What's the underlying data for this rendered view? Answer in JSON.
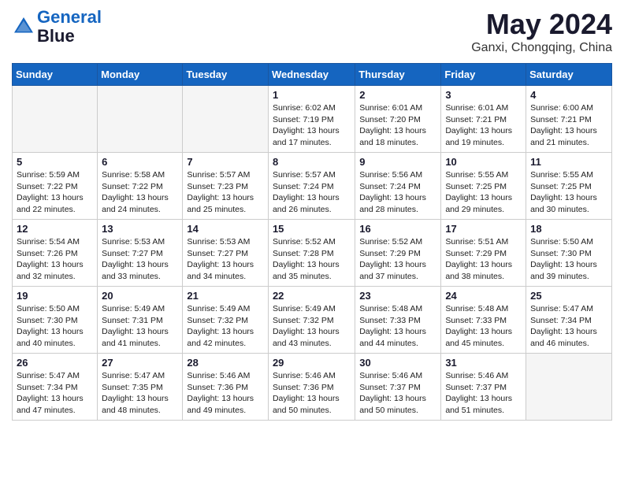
{
  "header": {
    "logo_line1": "General",
    "logo_line2": "Blue",
    "month": "May 2024",
    "location": "Ganxi, Chongqing, China"
  },
  "weekdays": [
    "Sunday",
    "Monday",
    "Tuesday",
    "Wednesday",
    "Thursday",
    "Friday",
    "Saturday"
  ],
  "weeks": [
    [
      {
        "num": "",
        "info": ""
      },
      {
        "num": "",
        "info": ""
      },
      {
        "num": "",
        "info": ""
      },
      {
        "num": "1",
        "info": "Sunrise: 6:02 AM\nSunset: 7:19 PM\nDaylight: 13 hours\nand 17 minutes."
      },
      {
        "num": "2",
        "info": "Sunrise: 6:01 AM\nSunset: 7:20 PM\nDaylight: 13 hours\nand 18 minutes."
      },
      {
        "num": "3",
        "info": "Sunrise: 6:01 AM\nSunset: 7:21 PM\nDaylight: 13 hours\nand 19 minutes."
      },
      {
        "num": "4",
        "info": "Sunrise: 6:00 AM\nSunset: 7:21 PM\nDaylight: 13 hours\nand 21 minutes."
      }
    ],
    [
      {
        "num": "5",
        "info": "Sunrise: 5:59 AM\nSunset: 7:22 PM\nDaylight: 13 hours\nand 22 minutes."
      },
      {
        "num": "6",
        "info": "Sunrise: 5:58 AM\nSunset: 7:22 PM\nDaylight: 13 hours\nand 24 minutes."
      },
      {
        "num": "7",
        "info": "Sunrise: 5:57 AM\nSunset: 7:23 PM\nDaylight: 13 hours\nand 25 minutes."
      },
      {
        "num": "8",
        "info": "Sunrise: 5:57 AM\nSunset: 7:24 PM\nDaylight: 13 hours\nand 26 minutes."
      },
      {
        "num": "9",
        "info": "Sunrise: 5:56 AM\nSunset: 7:24 PM\nDaylight: 13 hours\nand 28 minutes."
      },
      {
        "num": "10",
        "info": "Sunrise: 5:55 AM\nSunset: 7:25 PM\nDaylight: 13 hours\nand 29 minutes."
      },
      {
        "num": "11",
        "info": "Sunrise: 5:55 AM\nSunset: 7:25 PM\nDaylight: 13 hours\nand 30 minutes."
      }
    ],
    [
      {
        "num": "12",
        "info": "Sunrise: 5:54 AM\nSunset: 7:26 PM\nDaylight: 13 hours\nand 32 minutes."
      },
      {
        "num": "13",
        "info": "Sunrise: 5:53 AM\nSunset: 7:27 PM\nDaylight: 13 hours\nand 33 minutes."
      },
      {
        "num": "14",
        "info": "Sunrise: 5:53 AM\nSunset: 7:27 PM\nDaylight: 13 hours\nand 34 minutes."
      },
      {
        "num": "15",
        "info": "Sunrise: 5:52 AM\nSunset: 7:28 PM\nDaylight: 13 hours\nand 35 minutes."
      },
      {
        "num": "16",
        "info": "Sunrise: 5:52 AM\nSunset: 7:29 PM\nDaylight: 13 hours\nand 37 minutes."
      },
      {
        "num": "17",
        "info": "Sunrise: 5:51 AM\nSunset: 7:29 PM\nDaylight: 13 hours\nand 38 minutes."
      },
      {
        "num": "18",
        "info": "Sunrise: 5:50 AM\nSunset: 7:30 PM\nDaylight: 13 hours\nand 39 minutes."
      }
    ],
    [
      {
        "num": "19",
        "info": "Sunrise: 5:50 AM\nSunset: 7:30 PM\nDaylight: 13 hours\nand 40 minutes."
      },
      {
        "num": "20",
        "info": "Sunrise: 5:49 AM\nSunset: 7:31 PM\nDaylight: 13 hours\nand 41 minutes."
      },
      {
        "num": "21",
        "info": "Sunrise: 5:49 AM\nSunset: 7:32 PM\nDaylight: 13 hours\nand 42 minutes."
      },
      {
        "num": "22",
        "info": "Sunrise: 5:49 AM\nSunset: 7:32 PM\nDaylight: 13 hours\nand 43 minutes."
      },
      {
        "num": "23",
        "info": "Sunrise: 5:48 AM\nSunset: 7:33 PM\nDaylight: 13 hours\nand 44 minutes."
      },
      {
        "num": "24",
        "info": "Sunrise: 5:48 AM\nSunset: 7:33 PM\nDaylight: 13 hours\nand 45 minutes."
      },
      {
        "num": "25",
        "info": "Sunrise: 5:47 AM\nSunset: 7:34 PM\nDaylight: 13 hours\nand 46 minutes."
      }
    ],
    [
      {
        "num": "26",
        "info": "Sunrise: 5:47 AM\nSunset: 7:34 PM\nDaylight: 13 hours\nand 47 minutes."
      },
      {
        "num": "27",
        "info": "Sunrise: 5:47 AM\nSunset: 7:35 PM\nDaylight: 13 hours\nand 48 minutes."
      },
      {
        "num": "28",
        "info": "Sunrise: 5:46 AM\nSunset: 7:36 PM\nDaylight: 13 hours\nand 49 minutes."
      },
      {
        "num": "29",
        "info": "Sunrise: 5:46 AM\nSunset: 7:36 PM\nDaylight: 13 hours\nand 50 minutes."
      },
      {
        "num": "30",
        "info": "Sunrise: 5:46 AM\nSunset: 7:37 PM\nDaylight: 13 hours\nand 50 minutes."
      },
      {
        "num": "31",
        "info": "Sunrise: 5:46 AM\nSunset: 7:37 PM\nDaylight: 13 hours\nand 51 minutes."
      },
      {
        "num": "",
        "info": ""
      }
    ]
  ]
}
